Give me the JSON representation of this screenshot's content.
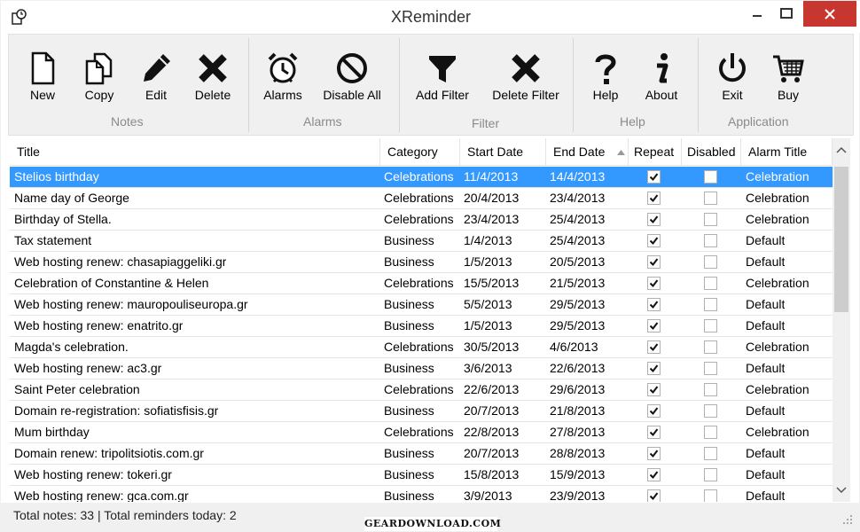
{
  "window": {
    "title": "XReminder"
  },
  "ribbon": {
    "groups": [
      {
        "label": "Notes",
        "tools": [
          {
            "label": "New",
            "icon": "new-document-icon"
          },
          {
            "label": "Copy",
            "icon": "copy-icon"
          },
          {
            "label": "Edit",
            "icon": "pencil-icon"
          },
          {
            "label": "Delete",
            "icon": "x-icon"
          }
        ]
      },
      {
        "label": "Alarms",
        "tools": [
          {
            "label": "Alarms",
            "icon": "alarm-clock-icon"
          },
          {
            "label": "Disable All",
            "icon": "prohibited-icon"
          }
        ]
      },
      {
        "label": "Filter",
        "tools": [
          {
            "label": "Add Filter",
            "icon": "funnel-icon"
          },
          {
            "label": "Delete Filter",
            "icon": "x-icon"
          }
        ]
      },
      {
        "label": "Help",
        "tools": [
          {
            "label": "Help",
            "icon": "question-icon"
          },
          {
            "label": "About",
            "icon": "info-icon"
          }
        ]
      },
      {
        "label": "Application",
        "tools": [
          {
            "label": "Exit",
            "icon": "power-icon"
          },
          {
            "label": "Buy",
            "icon": "cart-icon"
          }
        ]
      }
    ]
  },
  "grid": {
    "columns": [
      "Title",
      "Category",
      "Start Date",
      "End Date",
      "Repeat",
      "Disabled",
      "Alarm Title"
    ],
    "sorted_column": "End Date",
    "selected_row": 0,
    "rows": [
      {
        "title": "Stelios birthday",
        "category": "Celebrations",
        "start": "11/4/2013",
        "end": "14/4/2013",
        "repeat": true,
        "disabled": false,
        "alarm": "Celebration"
      },
      {
        "title": "Name day of George",
        "category": "Celebrations",
        "start": "20/4/2013",
        "end": "23/4/2013",
        "repeat": true,
        "disabled": false,
        "alarm": "Celebration"
      },
      {
        "title": "Birthday of Stella.",
        "category": "Celebrations",
        "start": "23/4/2013",
        "end": "25/4/2013",
        "repeat": true,
        "disabled": false,
        "alarm": "Celebration"
      },
      {
        "title": "Tax statement",
        "category": "Business",
        "start": "1/4/2013",
        "end": "25/4/2013",
        "repeat": true,
        "disabled": false,
        "alarm": "Default"
      },
      {
        "title": "Web hosting renew: chasapiaggeliki.gr",
        "category": "Business",
        "start": "1/5/2013",
        "end": "20/5/2013",
        "repeat": true,
        "disabled": false,
        "alarm": "Default"
      },
      {
        "title": "Celebration of Constantine & Helen",
        "category": "Celebrations",
        "start": "15/5/2013",
        "end": "21/5/2013",
        "repeat": true,
        "disabled": false,
        "alarm": "Celebration"
      },
      {
        "title": "Web hosting renew: mauropouliseuropa.gr",
        "category": "Business",
        "start": "5/5/2013",
        "end": "29/5/2013",
        "repeat": true,
        "disabled": false,
        "alarm": "Default"
      },
      {
        "title": "Web hosting renew: enatrito.gr",
        "category": "Business",
        "start": "1/5/2013",
        "end": "29/5/2013",
        "repeat": true,
        "disabled": false,
        "alarm": "Default"
      },
      {
        "title": "Magda's celebration.",
        "category": "Celebrations",
        "start": "30/5/2013",
        "end": "4/6/2013",
        "repeat": true,
        "disabled": false,
        "alarm": "Celebration"
      },
      {
        "title": "Web hosting renew: ac3.gr",
        "category": "Business",
        "start": "3/6/2013",
        "end": "22/6/2013",
        "repeat": true,
        "disabled": false,
        "alarm": "Default"
      },
      {
        "title": "Saint Peter celebration",
        "category": "Celebrations",
        "start": "22/6/2013",
        "end": "29/6/2013",
        "repeat": true,
        "disabled": false,
        "alarm": "Celebration"
      },
      {
        "title": "Domain re-registration: sofiatisfisis.gr",
        "category": "Business",
        "start": "20/7/2013",
        "end": "21/8/2013",
        "repeat": true,
        "disabled": false,
        "alarm": "Default"
      },
      {
        "title": "Mum birthday",
        "category": "Celebrations",
        "start": "22/8/2013",
        "end": "27/8/2013",
        "repeat": true,
        "disabled": false,
        "alarm": "Celebration"
      },
      {
        "title": "Domain renew: tripolitsiotis.com.gr",
        "category": "Business",
        "start": "20/7/2013",
        "end": "28/8/2013",
        "repeat": true,
        "disabled": false,
        "alarm": "Default"
      },
      {
        "title": "Web hosting renew: tokeri.gr",
        "category": "Business",
        "start": "15/8/2013",
        "end": "15/9/2013",
        "repeat": true,
        "disabled": false,
        "alarm": "Default"
      },
      {
        "title": "Web hosting renew: gca.com.gr",
        "category": "Business",
        "start": "3/9/2013",
        "end": "23/9/2013",
        "repeat": true,
        "disabled": false,
        "alarm": "Default"
      }
    ]
  },
  "status": {
    "text": "Total notes: 33 | Total reminders today: 2"
  },
  "watermark": {
    "text": "GEARDOWNLOAD.COM"
  },
  "colors": {
    "selection": "#3399ff",
    "close_button": "#c7372f",
    "ribbon_bg": "#f0f0f0"
  }
}
